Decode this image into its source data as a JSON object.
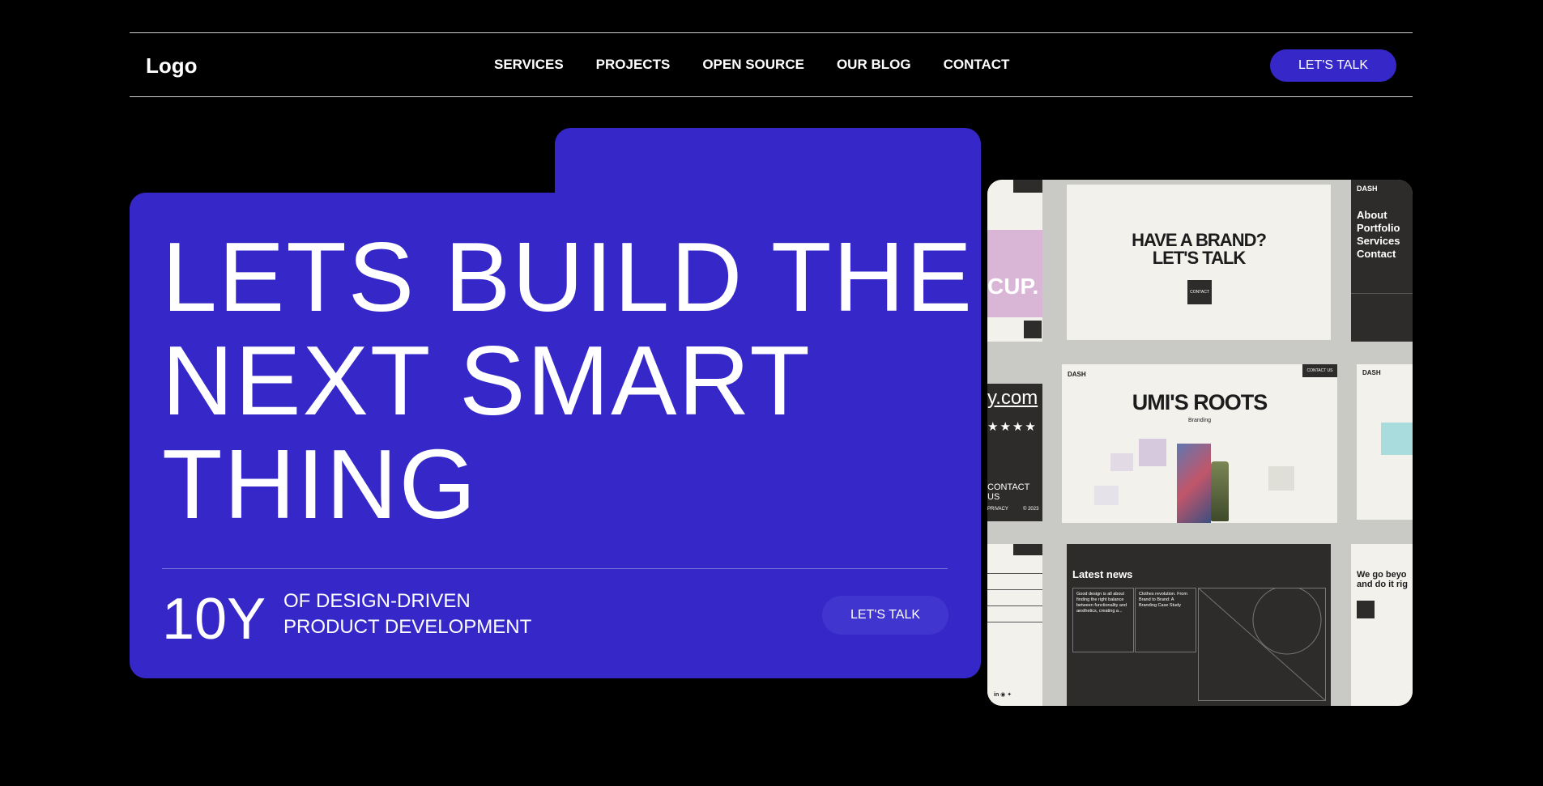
{
  "nav": {
    "logo": "Logo",
    "items": [
      "SERVICES",
      "PROJECTS",
      "OPEN SOURCE",
      "OUR BLOG",
      "CONTACT"
    ],
    "cta": "LET'S TALK"
  },
  "hero": {
    "headline": [
      "LETS BUILD THE",
      "NEXT SMART",
      "THING"
    ],
    "years": "10Y",
    "tagline": [
      "OF DESIGN-DRIVEN",
      "PRODUCT DEVELOPMENT"
    ],
    "cta": "LET'S TALK"
  },
  "mockup": {
    "brand_title": [
      "HAVE A BRAND?",
      "LET'S TALK"
    ],
    "brand_button": "CONTACT",
    "dash_label": "DASH",
    "dash_menu": [
      "About",
      "Portfolio",
      "Services",
      "Contact"
    ],
    "project_title": "UMI'S ROOTS",
    "project_tag": "Branding",
    "contact_us": "CONTACT US",
    "domain_fragment": "y.com",
    "stars": "★★★★",
    "cup_fragment": "CUP.",
    "news_title": "Latest news",
    "news_item_1": "Good design is all about finding the right balance between functionality and aesthetics, creating a...",
    "news_item_2": "Clothes revolution. From Brand to Brand: A Branding Case Study",
    "we_go": "We go beyo and do it rig",
    "privacy": "PRIVACY",
    "year": "© 2023",
    "contact_small": "CONTACT US"
  },
  "colors": {
    "accent": "#3628c8",
    "background": "#000000",
    "mock_light": "#f3f1ec",
    "mock_dark": "#2e2c2a"
  }
}
